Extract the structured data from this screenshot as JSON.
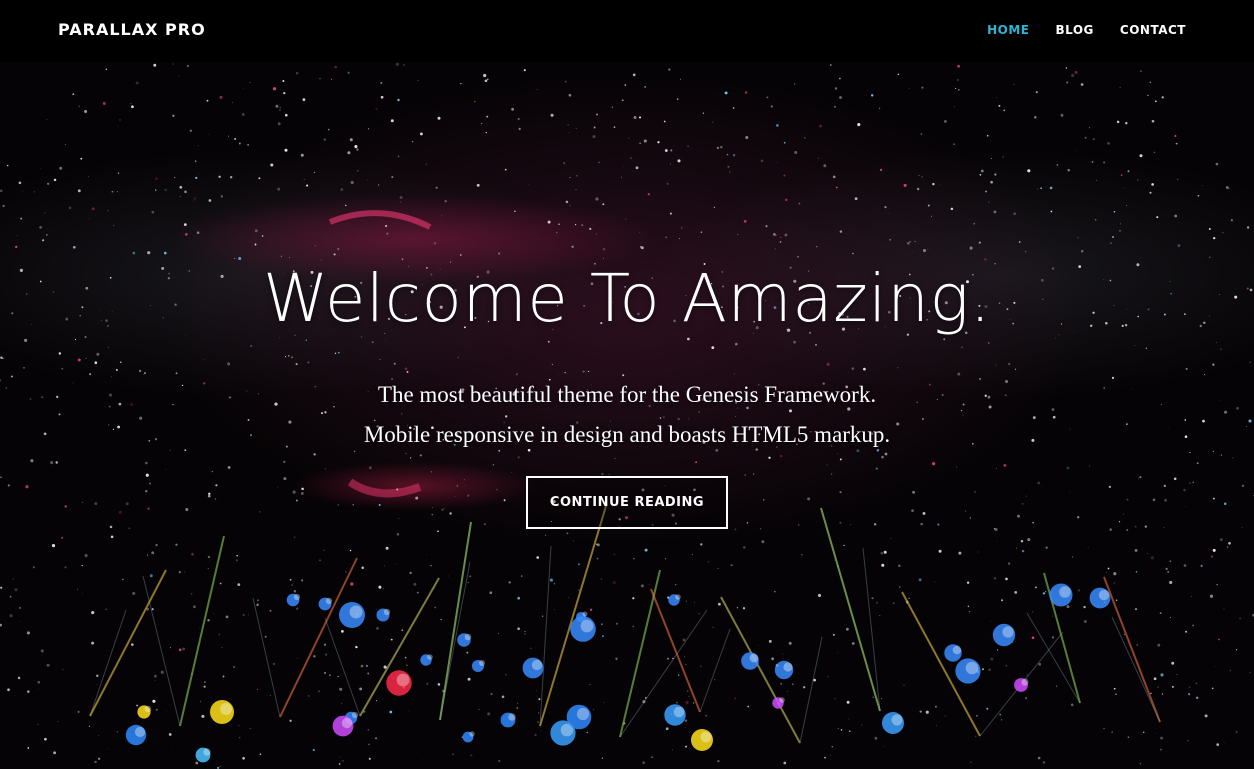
{
  "header": {
    "site_title": "PARALLAX PRO",
    "nav": [
      {
        "label": "HOME",
        "active": true
      },
      {
        "label": "BLOG",
        "active": false
      },
      {
        "label": "CONTACT",
        "active": false
      }
    ]
  },
  "hero": {
    "background": "fireworks-image",
    "title": "Welcome To Amazing.",
    "subtitle_line1": "The most beautiful theme for the Genesis Framework.",
    "subtitle_line2": "Mobile responsive in design and boasts HTML5 markup.",
    "cta_label": "CONTINUE READING"
  },
  "colors": {
    "background": "#000000",
    "text": "#ffffff",
    "nav_active": "#2bb5d6"
  }
}
